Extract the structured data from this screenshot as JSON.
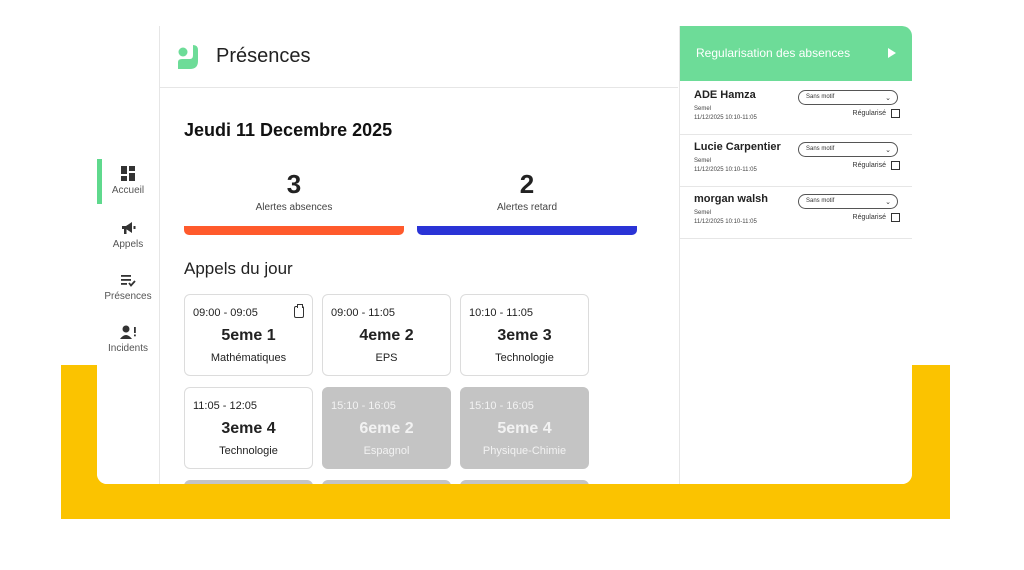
{
  "header": {
    "title": "Présences"
  },
  "sidebar": {
    "items": [
      {
        "label": "Accueil",
        "icon": "dashboard-icon",
        "active": true
      },
      {
        "label": "Appels",
        "icon": "megaphone-icon"
      },
      {
        "label": "Présences",
        "icon": "list-check-icon"
      },
      {
        "label": "Incidents",
        "icon": "user-alert-icon"
      }
    ]
  },
  "main": {
    "date": "Jeudi 11 Decembre 2025",
    "stats": [
      {
        "value": "3",
        "label": "Alertes absences",
        "color": "#ff5a2c"
      },
      {
        "value": "2",
        "label": "Alertes retard",
        "color": "#2a33d6"
      }
    ],
    "section_title": "Appels du jour",
    "cards": [
      {
        "time": "09:00 - 09:05",
        "class": "5eme 1",
        "subject": "Mathématiques",
        "done": false,
        "icon": "clipboard-icon"
      },
      {
        "time": "09:00 - 11:05",
        "class": "4eme 2",
        "subject": "EPS",
        "done": false
      },
      {
        "time": "10:10 - 11:05",
        "class": "3eme 3",
        "subject": "Technologie",
        "done": false
      },
      {
        "time": "11:05 - 12:05",
        "class": "3eme 4",
        "subject": "Technologie",
        "done": false
      },
      {
        "time": "15:10 - 16:05",
        "class": "6eme 2",
        "subject": "Espagnol",
        "done": true
      },
      {
        "time": "15:10 - 16:05",
        "class": "5eme 4",
        "subject": "Physique-Chimie",
        "done": true
      }
    ]
  },
  "panel": {
    "title": "Regularisation des absences",
    "regularise_label": "Régularisé",
    "items": [
      {
        "name": "ADE Hamza",
        "meta1": "Semel",
        "meta2": "11/12/2025 10:10-11:05",
        "motif": "Sans motif"
      },
      {
        "name": "Lucie Carpentier",
        "meta1": "Semel",
        "meta2": "11/12/2025 10:10-11:05",
        "motif": "Sans motif"
      },
      {
        "name": "morgan walsh",
        "meta1": "Semel",
        "meta2": "11/12/2025 10:10-11:05",
        "motif": "Sans motif"
      }
    ]
  },
  "colors": {
    "accent": "#6ddc98",
    "background_band": "#fbc300",
    "absence": "#ff5a2c",
    "retard": "#2a33d6",
    "done_card": "#c4c4c4"
  }
}
